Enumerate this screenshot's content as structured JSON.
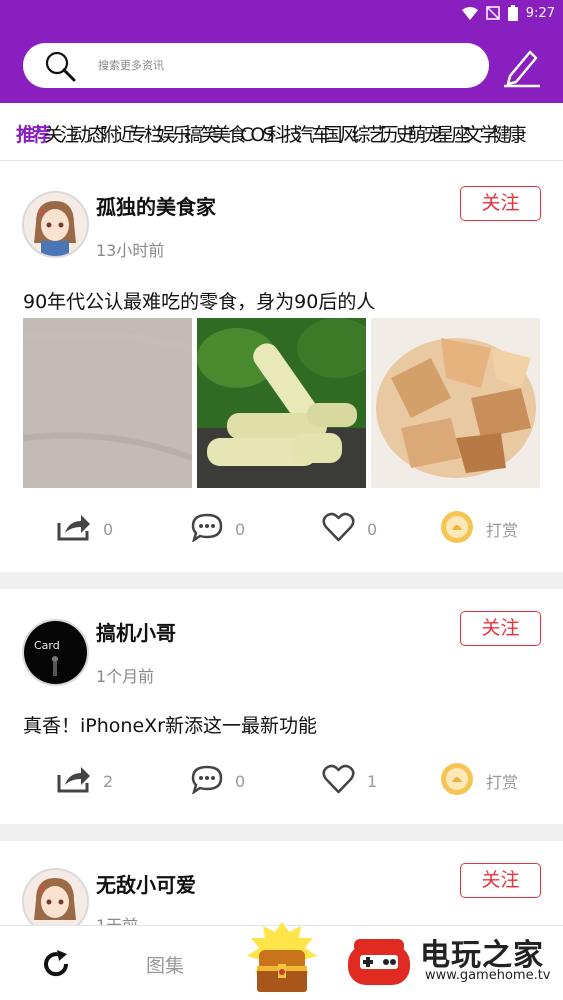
{
  "status_bar": {
    "time": "9:27"
  },
  "search": {
    "placeholder": "搜索更多资讯"
  },
  "tabs": [
    "推荐",
    "关注",
    "动态",
    "附近",
    "专栏",
    "娱乐",
    "搞笑",
    "美食",
    "COS",
    "科技",
    "汽车",
    "国风",
    "综艺",
    "历史",
    "萌宠",
    "星座",
    "文学",
    "健康"
  ],
  "active_tab": "推荐",
  "posts": [
    {
      "author": "孤独的美食家",
      "time": "13小时前",
      "follow_label": "关注",
      "title": "90年代公认最难吃的零食，身为90后的人",
      "share_count": "0",
      "comment_count": "0",
      "like_count": "0",
      "tip_label": "打赏"
    },
    {
      "author": "搞机小哥",
      "time": "1个月前",
      "follow_label": "关注",
      "avatar_text": "Card",
      "title": "真香！iPhoneXr新添这一最新功能",
      "share_count": "2",
      "comment_count": "0",
      "like_count": "1",
      "tip_label": "打赏"
    },
    {
      "author": "无敌小可爱",
      "time": "1天前",
      "follow_label": "关注"
    }
  ],
  "bottom_nav": {
    "atlas_label": "图集"
  },
  "watermark": {
    "name": "电玩之家",
    "url": "www.gamehome.tv"
  },
  "colors": {
    "brand": "#8a1fc0",
    "follow": "#e8333a"
  },
  "icons": [
    "search-icon",
    "edit-icon",
    "share-icon",
    "comment-icon",
    "heart-icon",
    "coin-icon",
    "refresh-icon",
    "treasure-chest-icon"
  ]
}
